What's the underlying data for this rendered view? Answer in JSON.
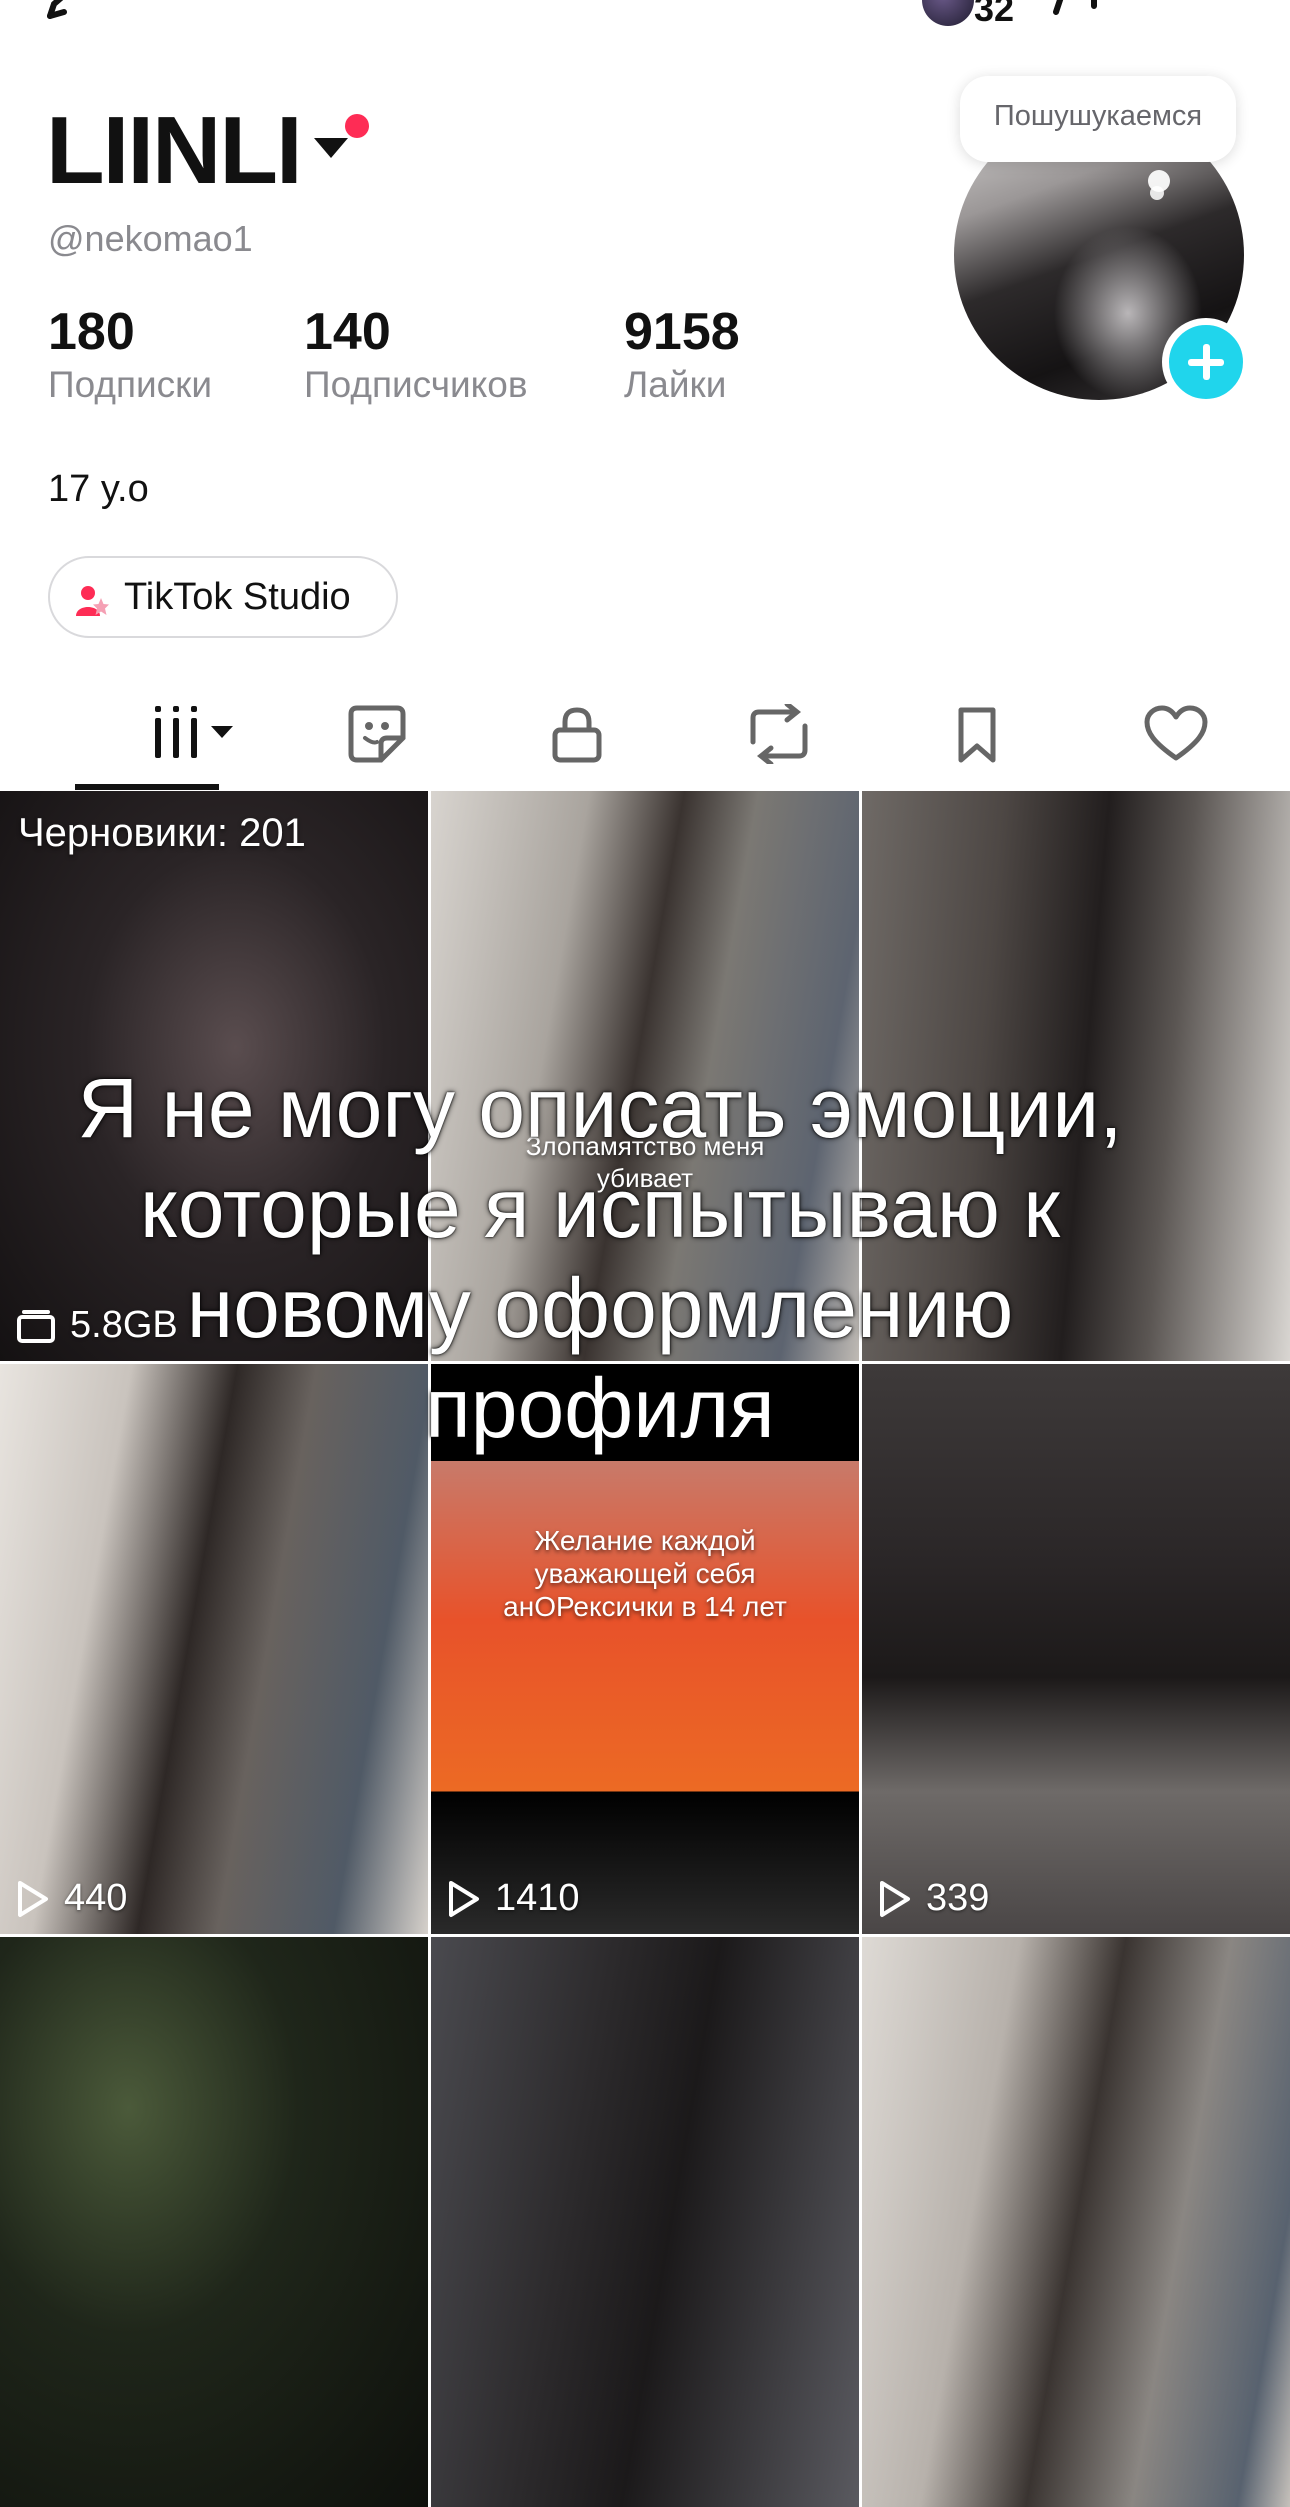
{
  "top_bar": {
    "inbox_count": "32"
  },
  "profile": {
    "username": "LIINLI",
    "handle": "@nekomao1",
    "avatar_bubble": "Пошушукаемся",
    "stats": [
      {
        "value": "180",
        "label": "Подписки"
      },
      {
        "value": "140",
        "label": "Подписчиков"
      },
      {
        "value": "9158",
        "label": "Лайки"
      }
    ],
    "bio": "17 y.o",
    "studio_button": "TikTok Studio"
  },
  "tabs": [
    {
      "name": "videos",
      "icon": "grid-bars-icon",
      "active": true
    },
    {
      "name": "stickers",
      "icon": "sticker-icon"
    },
    {
      "name": "private",
      "icon": "lock-icon"
    },
    {
      "name": "reposts",
      "icon": "repost-icon"
    },
    {
      "name": "favorites",
      "icon": "bookmark-icon"
    },
    {
      "name": "liked",
      "icon": "heart-icon"
    }
  ],
  "grid": {
    "drafts_label": "Черновики: 201",
    "drafts_size": "5.8GB",
    "video_overlay_1": "Злопамятство меня",
    "video_overlay_1b": "убивает",
    "video_overlay_2": "Желание каждой уважающей себя анОРексички в 14 лет",
    "views": [
      "440",
      "1410",
      "339"
    ]
  },
  "caption": "Я не могу описать эмоции, которые я испытываю к новому оформлению профиля",
  "colors": {
    "accent_red": "#fe2c55",
    "accent_cyan": "#20d5ec",
    "text_secondary": "#8a8a8f"
  }
}
